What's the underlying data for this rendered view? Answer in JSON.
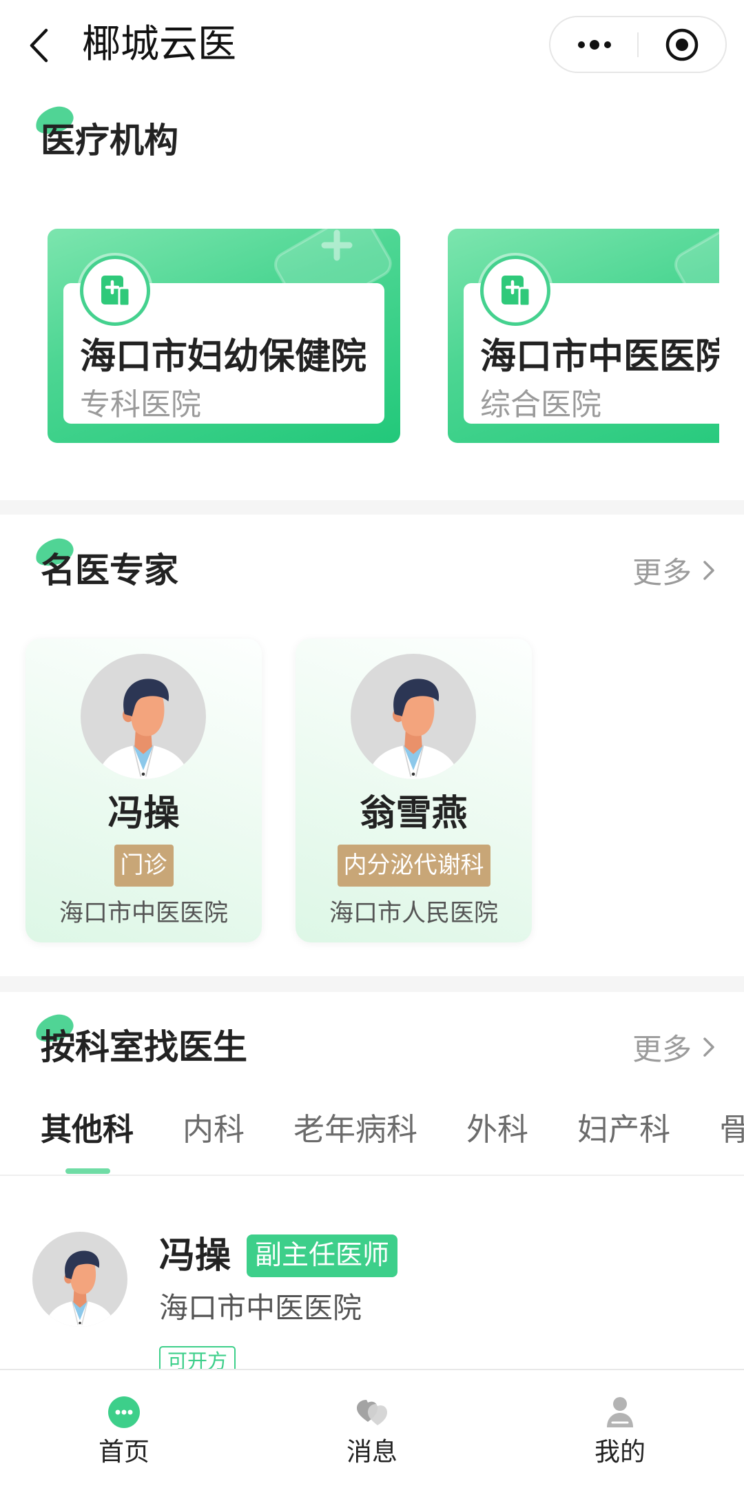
{
  "header": {
    "title": "椰城云医",
    "back_icon": "chevron-left-icon",
    "more_icon": "more-dots-icon",
    "exit_icon": "target-icon"
  },
  "colors": {
    "primary": "#3DCF8A",
    "primary_light": "#6FDCA5",
    "tag_tan": "#C8A677",
    "separator": "#F5F5F5",
    "text_main": "#222222",
    "text_secondary": "#999999"
  },
  "institutions": {
    "title": "医疗机构",
    "icon": "hospital-card-icon",
    "items": [
      {
        "name": "海口市妇幼保健院",
        "type": "专科医院"
      },
      {
        "name": "海口市中医医院",
        "type": "综合医院"
      }
    ]
  },
  "experts": {
    "title": "名医专家",
    "more_label": "更多",
    "items": [
      {
        "name": "冯操",
        "department": "门诊",
        "hospital": "海口市中医医院",
        "avatar": "doctor-avatar-icon"
      },
      {
        "name": "翁雪燕",
        "department": "内分泌代谢科",
        "hospital": "海口市人民医院",
        "avatar": "doctor-avatar-icon"
      }
    ]
  },
  "departments": {
    "title": "按科室找医生",
    "more_label": "更多",
    "active_tab": 0,
    "tabs": [
      "其他科",
      "内科",
      "老年病科",
      "外科",
      "妇产科",
      "骨"
    ],
    "doctors": [
      {
        "name": "冯操",
        "title": "副主任医师",
        "hospital": "海口市中医医院",
        "tags": [
          "可开方"
        ],
        "avatar": "doctor-avatar-icon"
      }
    ]
  },
  "tabbar": {
    "items": [
      {
        "label": "首页",
        "icon": "home-chat-icon",
        "active": true
      },
      {
        "label": "消息",
        "icon": "message-icon",
        "active": false
      },
      {
        "label": "我的",
        "icon": "profile-icon",
        "active": false
      }
    ]
  }
}
